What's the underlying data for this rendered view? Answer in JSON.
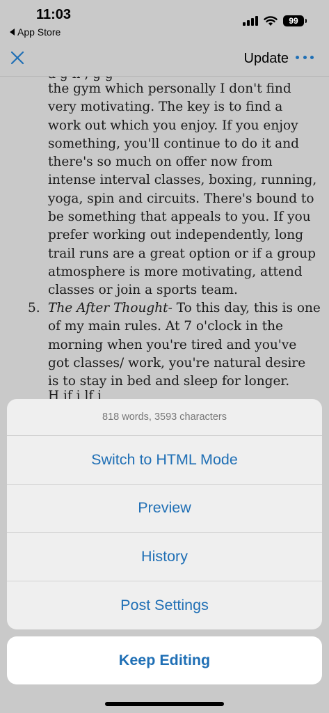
{
  "status_bar": {
    "time": "11:03",
    "back_label": "App Store",
    "battery": "99",
    "icons": [
      "signal-icon",
      "wifi-icon",
      "battery-icon"
    ]
  },
  "nav": {
    "close_icon": "close-icon",
    "update_label": "Update",
    "more_icon": "more-icon"
  },
  "article": {
    "cut_top": "a        g       h           ,      g        g",
    "para4_lines": [
      "the gym which personally I don't find",
      "very motivating. The key is to find a",
      "work out which you enjoy. If you enjoy",
      "something, you'll continue to do it and",
      "there's so much on offer now from",
      "intense interval classes, boxing, running,",
      "yoga, spin and circuits. There's bound to",
      "be something that appeals to you. If you",
      "prefer working out independently, long",
      "trail runs are a great option or if a group",
      "atmosphere is more motivating, attend",
      "classes or join a sports team."
    ],
    "item5_number": "5.",
    "item5_title": "The After Thought-",
    "item5_first_rest": " To this day, this is one",
    "item5_lines": [
      "of my main rules. At 7 o'clock in the",
      "morning when you're tired and you've",
      "got classes/ work, you're natural desire",
      "is to stay in bed and sleep for longer."
    ],
    "cut_bottom": "H          if             i          lf  i"
  },
  "sheet": {
    "info": "818 words, 3593 characters",
    "actions": [
      "Switch to HTML Mode",
      "Preview",
      "History",
      "Post Settings"
    ],
    "cancel": "Keep Editing"
  },
  "colors": {
    "accent": "#1f6fb5",
    "background": "#c9c9c9",
    "sheet": "#efefef"
  }
}
